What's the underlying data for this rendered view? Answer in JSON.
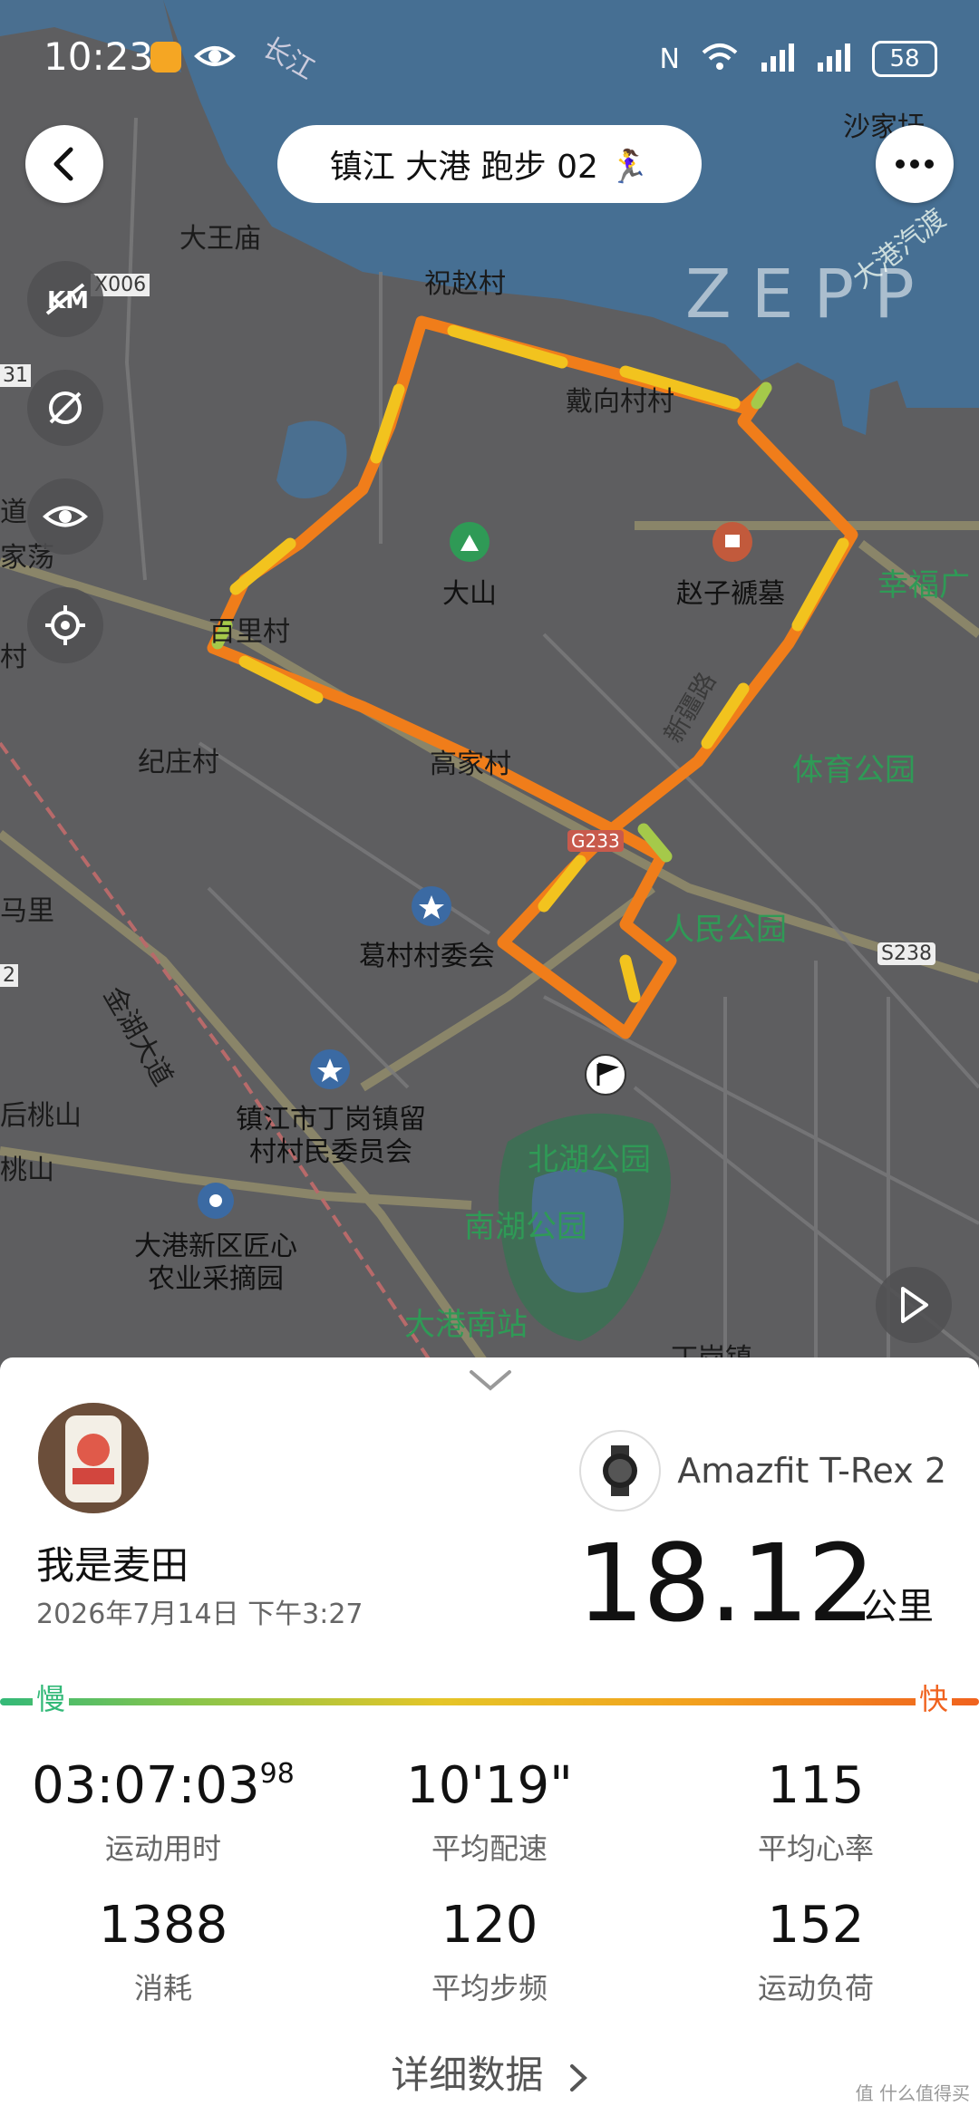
{
  "status_bar": {
    "time": "10:23",
    "battery": "58",
    "network": "6"
  },
  "header": {
    "title": "镇江 大港 跑步 02 🏃‍♀️"
  },
  "map": {
    "brand": "ZEPP",
    "labels": {
      "changjiang": "长江",
      "shajiagan": "沙家圩",
      "dawangmiao": "大王庙",
      "zhuzhaocun": "祝赵村",
      "x006": "X006",
      "daixiangcun": "戴向村村",
      "dagangqigang": "大港汽渡",
      "dashan": "大山",
      "zhaozimu": "赵子褫墓",
      "xingfu": "幸福广",
      "jiajiadang": "家荡",
      "baili": "百里村",
      "jizhuang": "纪庄村",
      "gaojia": "高家村",
      "tiyu": "体育公园",
      "mali": "马里",
      "jinhu": "金湖大道",
      "g233": "G233",
      "gecun": "葛村村委会",
      "renmin": "人民公园",
      "s238": "S238",
      "houtaoshan": "后桃山",
      "taoshan": "桃山",
      "dinggang": "镇江市丁岗镇留村村民委员会",
      "beihu": "北湖公园",
      "nanhu": "南湖公园",
      "jiangxin": "大港新区匠心农业采摘园",
      "dagangnan": "大港南站",
      "dinggangzhen": "丁岗镇",
      "left31": "31",
      "left2": "2",
      "leftdao": "道",
      "leftcun": "村",
      "xinjiang": "新疆路"
    }
  },
  "profile": {
    "username": "我是麦田",
    "datetime": "2026年7月14日 下午3:27"
  },
  "device": {
    "name": "Amazfit T-Rex 2"
  },
  "distance": {
    "value": "18.12",
    "unit": "公里"
  },
  "pace_scale": {
    "slow": "慢",
    "fast": "快"
  },
  "stats": [
    {
      "value": "03:07:03",
      "sup": "98",
      "label": "运动用时"
    },
    {
      "value": "10'19\"",
      "sup": "",
      "label": "平均配速"
    },
    {
      "value": "115",
      "sup": "",
      "label": "平均心率"
    },
    {
      "value": "1388",
      "sup": "",
      "label": "消耗"
    },
    {
      "value": "120",
      "sup": "",
      "label": "平均步频"
    },
    {
      "value": "152",
      "sup": "",
      "label": "运动负荷"
    }
  ],
  "detail_link": "详细数据",
  "watermark": "值 什么值得买",
  "colors": {
    "route_orange": "#f07d1a",
    "route_yellow": "#f2c31e",
    "water": "#466f93",
    "park_green": "#2f9a56"
  }
}
